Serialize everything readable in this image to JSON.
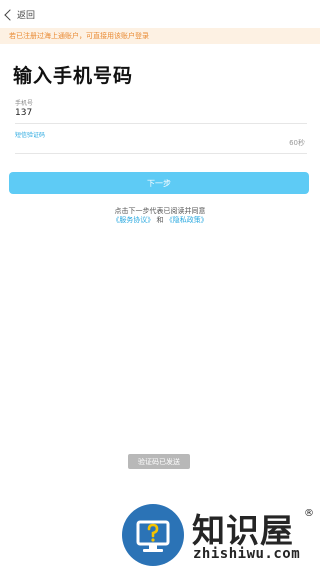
{
  "header": {
    "back_label": "返回"
  },
  "notice": {
    "text": "若已注册过海上通账户，可直接用该账户登录"
  },
  "page": {
    "title": "输入手机号码"
  },
  "phone_field": {
    "label": "手机号",
    "value": "137"
  },
  "code_field": {
    "label": "短信验证码",
    "value": "",
    "countdown": "60秒"
  },
  "next_button": {
    "label": "下一步"
  },
  "agreement": {
    "prefix": "点击下一步代表已阅读并同意",
    "service_link": "《服务协议》",
    "conjunction": "和",
    "privacy_link": "《隐私政策》"
  },
  "toast": {
    "text": "验证码已发送"
  },
  "watermark": {
    "name": "知识屋",
    "registered_mark": "®",
    "url": "zhishiwu.com",
    "logo_icon": "question-monitor-icon",
    "logo_color": "#2b73b6"
  },
  "colors": {
    "accent": "#2aa9e0",
    "button": "#5ecbf5",
    "notice_bg": "#fdf1e3",
    "notice_text": "#e98a33"
  }
}
